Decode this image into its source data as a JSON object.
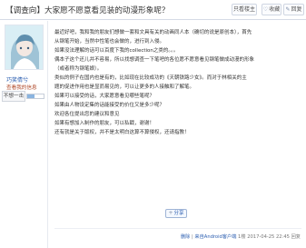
{
  "header": {
    "title": "【调查向】大家愿不愿意看见装的动漫形象呢？",
    "only_author": "只看楼主",
    "collect": "收藏",
    "reply": "回复"
  },
  "user": {
    "name": "巧笑倩兮",
    "reputation": "查看我的信息",
    "level": "不想一击",
    "exp_fraction": 0.45
  },
  "post": {
    "lines": [
      "最近好吧，我和我的朋友们想做一套和文具有关的动画同人本（确切的说是原创本），首先",
      "从钢笔开始，当然中性笔也会做的，进行到入侵。",
      "如果没法理解的话可以百度下我的collection之类的。。。",
      "偶本子这个还儿并不容易，所以找想调查一下笔吧的各位愿不愿意看见钢笔做成动漫的形象",
      "（或者称为钢笔娘）。",
      "类似的例子在国内也是有的，比如现在比较成功的《天朝铁路少女》。而对于林相关的主",
      "题的促进作用也是显而易见的，可以让更多的人接触和了解笔。",
      "如果可以接受的话，大家愿意看见哪些笔呢？",
      "如果由人物设定集的话能接受的价位又是多少呢？",
      "欢迎各位提出您的建议和意见",
      "如果有想加入制作的朋友，可以私戳，谢谢！",
      "还有就是关于版权，并不是太明白这算不算侵权，还请指教！"
    ]
  },
  "share": {
    "label": "分享"
  },
  "footer": {
    "delete": "删除",
    "client": "来自Android客户端",
    "floor": "1楼",
    "timestamp": "2017-04-25 22:45",
    "reply": "回复"
  }
}
